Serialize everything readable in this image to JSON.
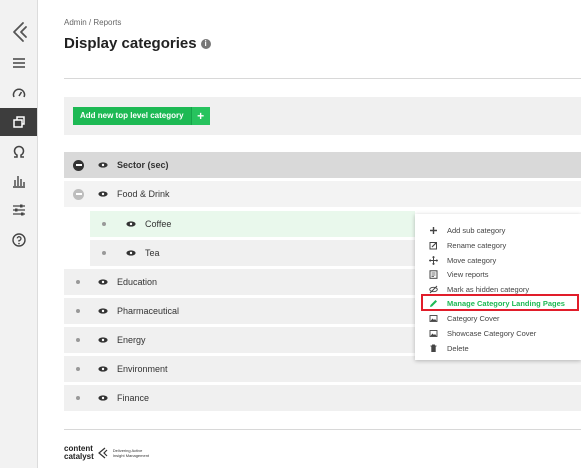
{
  "sidebar": {
    "items": [
      {
        "icon": "menu-icon"
      },
      {
        "icon": "dashboard-gauge-icon"
      },
      {
        "icon": "categories-icon",
        "active": true
      },
      {
        "icon": "omega-icon"
      },
      {
        "icon": "bar-chart-icon"
      },
      {
        "icon": "sliders-icon"
      },
      {
        "icon": "help-icon"
      }
    ]
  },
  "header": {
    "breadcrumb": "Admin / Reports",
    "title": "Display categories"
  },
  "toolbar": {
    "add_label": "Add new top level category",
    "add_plus": "+"
  },
  "tree": {
    "root": "Sector (sec)",
    "food": "Food & Drink",
    "coffee": "Coffee",
    "tea": "Tea",
    "education": "Education",
    "pharma": "Pharmaceutical",
    "energy": "Energy",
    "environment": "Environment",
    "finance": "Finance"
  },
  "context_menu": {
    "add_sub": "Add sub category",
    "rename": "Rename category",
    "move": "Move category",
    "view_reports": "View reports",
    "mark_hidden": "Mark as hidden category",
    "manage_landing": "Manage Category Landing Pages",
    "cover": "Category Cover",
    "showcase": "Showcase Category Cover",
    "delete": "Delete"
  },
  "footer": {
    "logo_line1": "content",
    "logo_line2": "catalyst",
    "tagline1": "Delivering Active",
    "tagline2": "Insight Management"
  },
  "colors": {
    "accent_green": "#1db954",
    "highlight_red": "#e11d2a",
    "sidebar_active": "#3d3d3d"
  }
}
